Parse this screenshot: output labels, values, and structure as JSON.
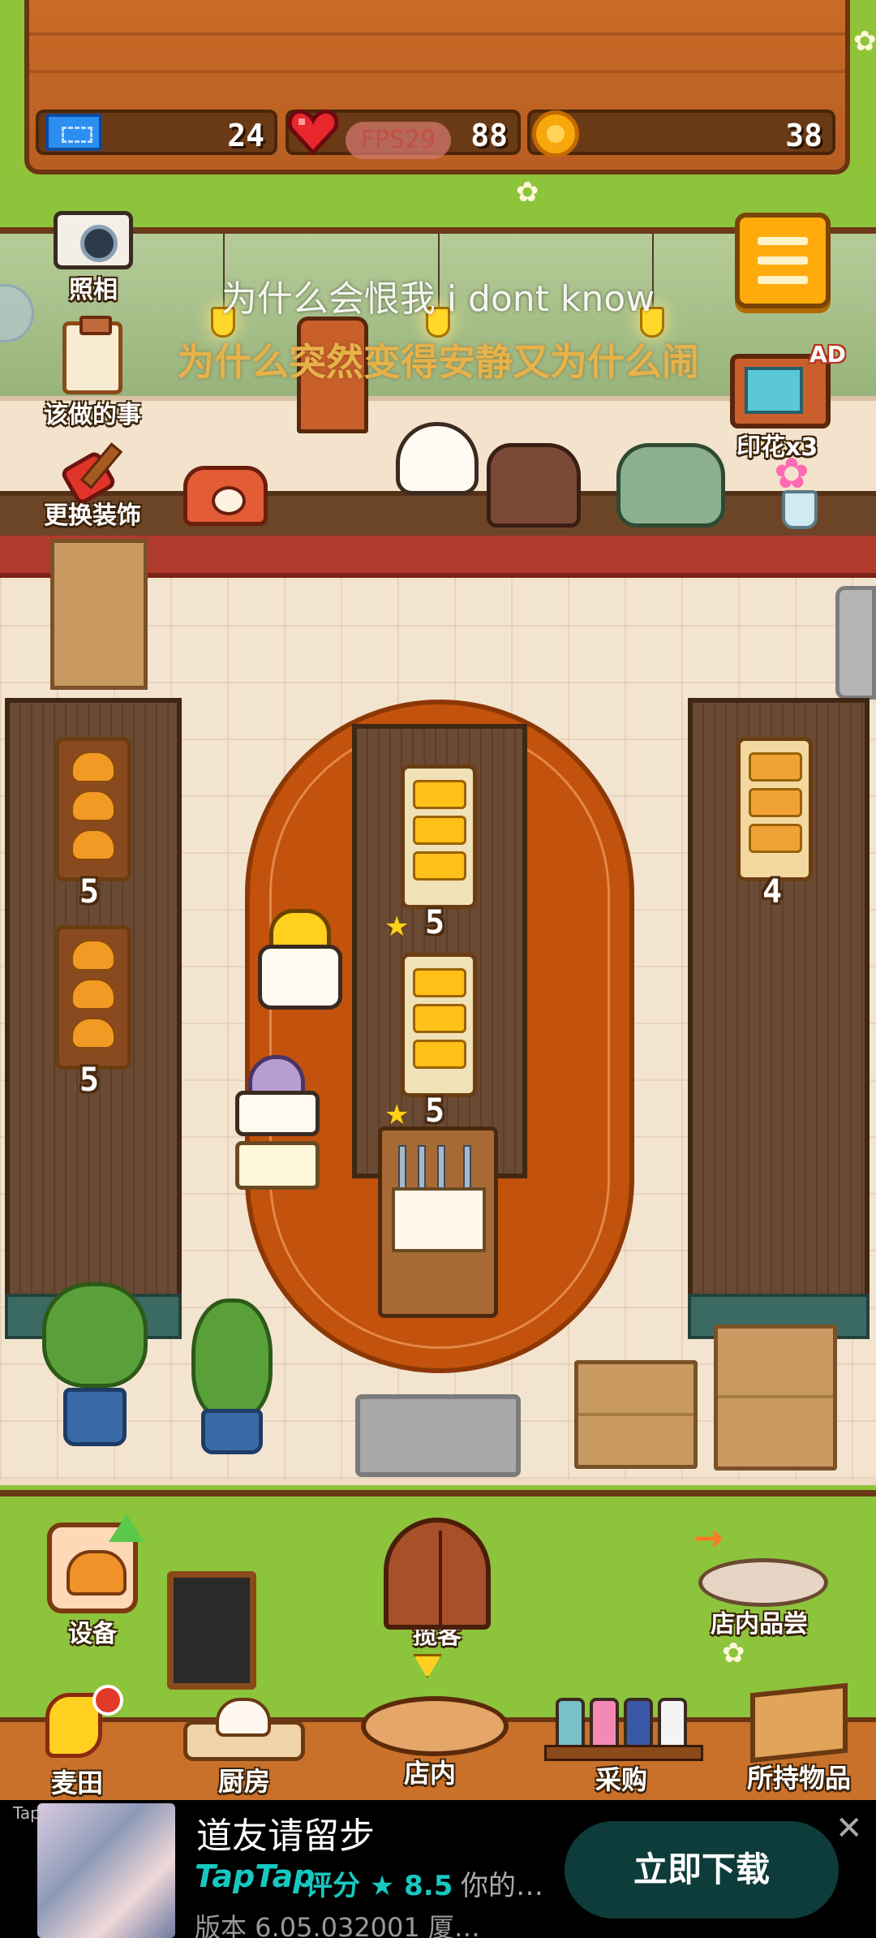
{
  "hud": {
    "tickets": "24",
    "hearts": "88",
    "coins": "38",
    "fps": "FPS29"
  },
  "lyrics": {
    "line1": "为什么会恨我 i dont know",
    "line2": "为什么突然变得安静又为什么闹"
  },
  "left_menu": {
    "photo": "照相",
    "todo": "该做的事",
    "decor": "更换装饰"
  },
  "stamp": {
    "ad_tag": "AD",
    "label": "印花x3"
  },
  "shelves": {
    "left_top_count": "5",
    "left_bottom_count": "5",
    "center_top_count": "5",
    "center_bottom_count": "5",
    "right_count": "4"
  },
  "actions": {
    "equipment": "设备",
    "customers": "揽客",
    "tasting": "店内品尝"
  },
  "nav": {
    "field": "麦田",
    "kitchen": "厨房",
    "store": "店内",
    "purchase": "采购",
    "items": "所持物品"
  },
  "ad": {
    "corner": "Tap",
    "title": "道友请留步",
    "brand": "TapTap",
    "rating": "评分 ★ 8.5",
    "desc": "你的…",
    "version": "版本 6.05.032001   厦…",
    "button": "立即下载",
    "close": "✕"
  },
  "colors": {
    "wood": "#c96b28",
    "grass": "#8cc43c",
    "rug": "#c2520c",
    "accent_orange": "#ffab0c",
    "taptap_teal": "#17c8c0"
  }
}
